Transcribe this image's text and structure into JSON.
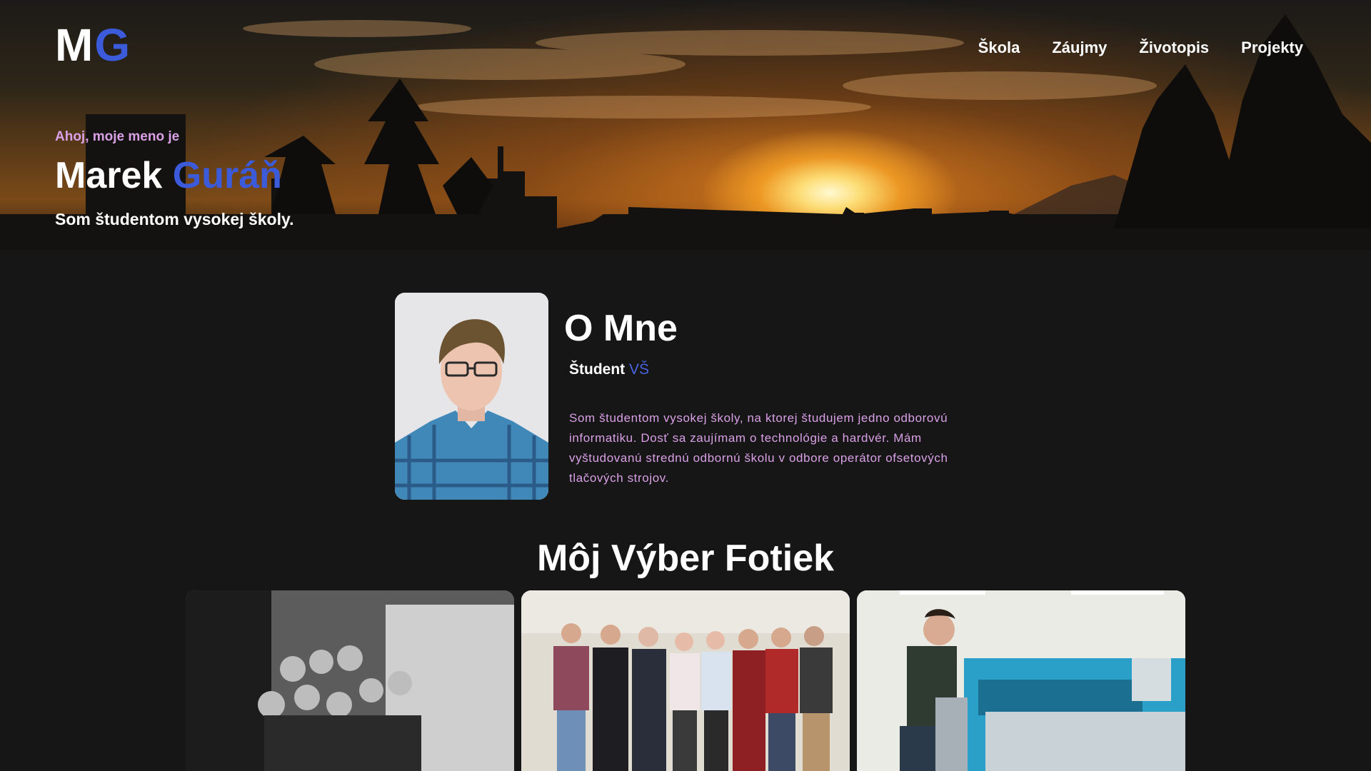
{
  "logo": {
    "first": "M",
    "second": "G"
  },
  "nav": {
    "items": [
      "Škola",
      "Záujmy",
      "Životopis",
      "Projekty"
    ]
  },
  "hero": {
    "greeting": "Ahoj, moje meno je",
    "first_name": "Marek",
    "last_name": "Guráň",
    "tagline": "Som študentom vysokej školy."
  },
  "about": {
    "title": "O Mne",
    "subtitle": "Študent",
    "subtitle_accent": "VŠ",
    "text": "Som študentom vysokej školy, na ktorej študujem jedno odborovú informatiku. Dosť sa zaujímam o technológie a hardvér. Mám vyštudovanú strednú odbornú školu v odbore operátor ofsetových tlačových strojov."
  },
  "gallery": {
    "title": "Môj Výber Fotiek"
  },
  "colors": {
    "accent_blue": "#3b5bdb",
    "accent_pink": "#d9a0e6",
    "background": "#161616"
  }
}
